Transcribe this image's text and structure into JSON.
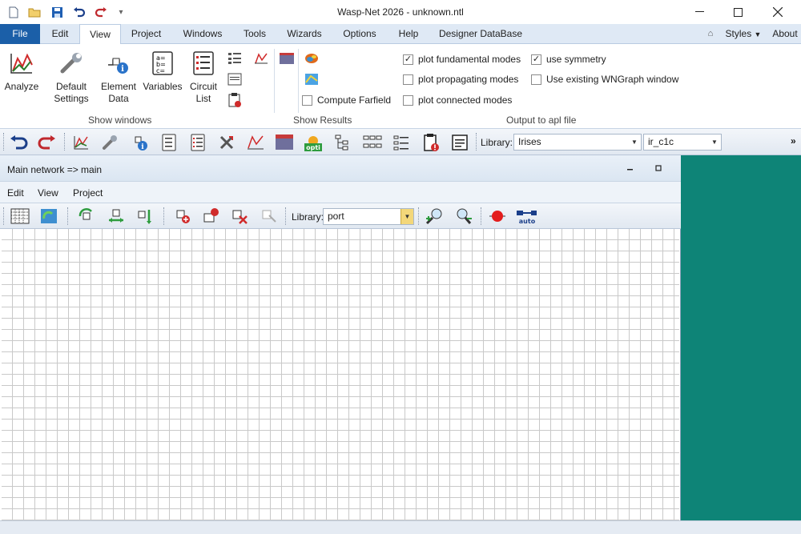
{
  "window": {
    "title": "Wasp-Net 2026 - unknown.ntl"
  },
  "menu": {
    "file": "File",
    "edit": "Edit",
    "view": "View",
    "project": "Project",
    "windows": "Windows",
    "tools": "Tools",
    "wizards": "Wizards",
    "options": "Options",
    "help": "Help",
    "designer_db": "Designer DataBase",
    "styles": "Styles",
    "about": "About"
  },
  "ribbon": {
    "analyze": "Analyze",
    "default_settings_1": "Default",
    "default_settings_2": "Settings",
    "element_data_1": "Element",
    "element_data_2": "Data",
    "variables": "Variables",
    "circuit_list_1": "Circuit",
    "circuit_list_2": "List",
    "compute_farfield": "Compute Farfield",
    "plot_fundamental": "plot fundamental modes",
    "plot_propagating": "plot propagating modes",
    "plot_connected": "plot connected modes",
    "use_symmetry": "use symmetry",
    "use_existing_wngraph": "Use existing WNGraph window",
    "group_show_windows": "Show windows",
    "group_show_results": "Show Results",
    "group_output_apl": "Output to apl file"
  },
  "checkboxes": {
    "compute_farfield": false,
    "plot_fundamental": true,
    "plot_propagating": false,
    "plot_connected": false,
    "use_symmetry": true,
    "use_existing_wngraph": false
  },
  "toolbar": {
    "library_label": "Library:",
    "library_value": "Irises",
    "element_value": "ir_c1c"
  },
  "subwindow": {
    "title": "Main network  => main",
    "menu_edit": "Edit",
    "menu_view": "View",
    "menu_project": "Project",
    "library_label": "Library:",
    "library_value": "port"
  },
  "colors": {
    "workspace_bg": "#0e8477",
    "file_tab": "#1b5fa8",
    "ribbon_tab_bar": "#dfe9f5"
  }
}
